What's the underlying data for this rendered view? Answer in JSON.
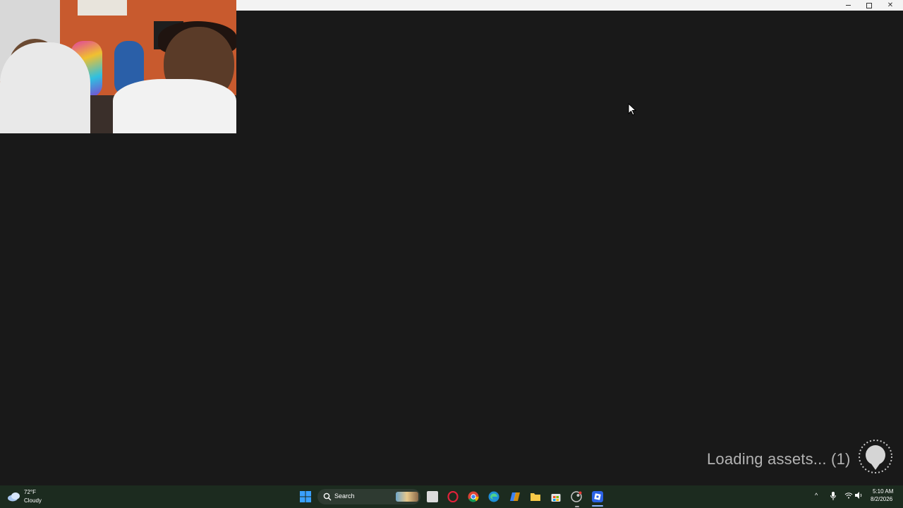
{
  "window": {
    "minimize_label": "–",
    "maximize_label": "",
    "close_label": "✕"
  },
  "loading": {
    "text": "Loading assets... (1)",
    "text_color": "#b3b3b3"
  },
  "taskbar": {
    "weather": {
      "temperature": "72°F",
      "condition": "Cloudy",
      "icon": "cloud-icon"
    },
    "search": {
      "label": "Search",
      "icon": "search-icon"
    },
    "apps": [
      {
        "name": "start-icon"
      },
      {
        "name": "task-view-icon"
      },
      {
        "name": "opera-icon"
      },
      {
        "name": "chrome-icon"
      },
      {
        "name": "edge-icon"
      },
      {
        "name": "copilot-icon"
      },
      {
        "name": "file-explorer-icon"
      },
      {
        "name": "store-icon"
      },
      {
        "name": "steam-icon"
      },
      {
        "name": "roblox-icon"
      }
    ],
    "tray": {
      "chevron": "^",
      "icons": [
        "microphone-icon",
        "wifi-icon",
        "volume-icon"
      ]
    },
    "clock": {
      "time": "5:10 AM",
      "date": "8/2/2026"
    }
  },
  "colors": {
    "background": "#191919",
    "titlebar": "#f3f3f3",
    "taskbar": "#1c2b1f"
  }
}
